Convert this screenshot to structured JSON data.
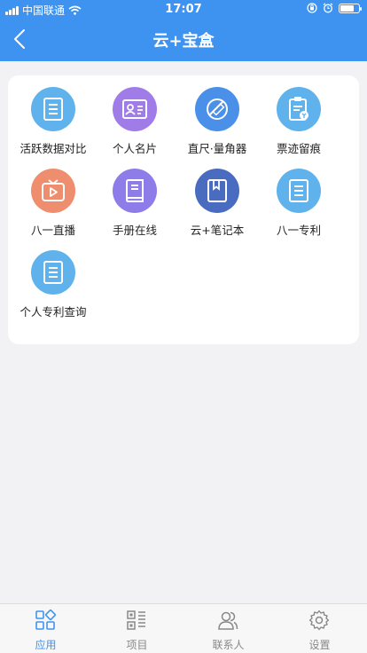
{
  "status_bar": {
    "carrier": "中国联通",
    "time": "17:07",
    "battery_level": 0.75
  },
  "nav": {
    "title": "云+宝盒",
    "back_icon": "chevron-left-icon"
  },
  "apps": [
    {
      "label": "活跃数据对比",
      "icon": "document-icon",
      "color": "#5fb2ec"
    },
    {
      "label": "个人名片",
      "icon": "id-card-icon",
      "color": "#a07ce8"
    },
    {
      "label": "直尺·量角器",
      "icon": "ruler-icon",
      "color": "#4a8fe8"
    },
    {
      "label": "票迹留痕",
      "icon": "clipboard-icon",
      "color": "#5fb2ec"
    },
    {
      "label": "八一直播",
      "icon": "tv-play-icon",
      "color": "#ef8e6e"
    },
    {
      "label": "手册在线",
      "icon": "book-icon",
      "color": "#8e7de8"
    },
    {
      "label": "云+笔记本",
      "icon": "notebook-icon",
      "color": "#4a6cc0"
    },
    {
      "label": "八一专利",
      "icon": "document-icon",
      "color": "#5fb2ec"
    },
    {
      "label": "个人专利查询",
      "icon": "document-icon",
      "color": "#5fb2ec"
    }
  ],
  "tabs": [
    {
      "label": "应用",
      "icon": "grid-apps-icon",
      "active": true
    },
    {
      "label": "项目",
      "icon": "qr-project-icon",
      "active": false
    },
    {
      "label": "联系人",
      "icon": "contacts-icon",
      "active": false
    },
    {
      "label": "设置",
      "icon": "gear-icon",
      "active": false
    }
  ],
  "colors": {
    "accent": "#3f93f0",
    "background": "#f2f2f4",
    "tab_inactive": "#888888"
  }
}
